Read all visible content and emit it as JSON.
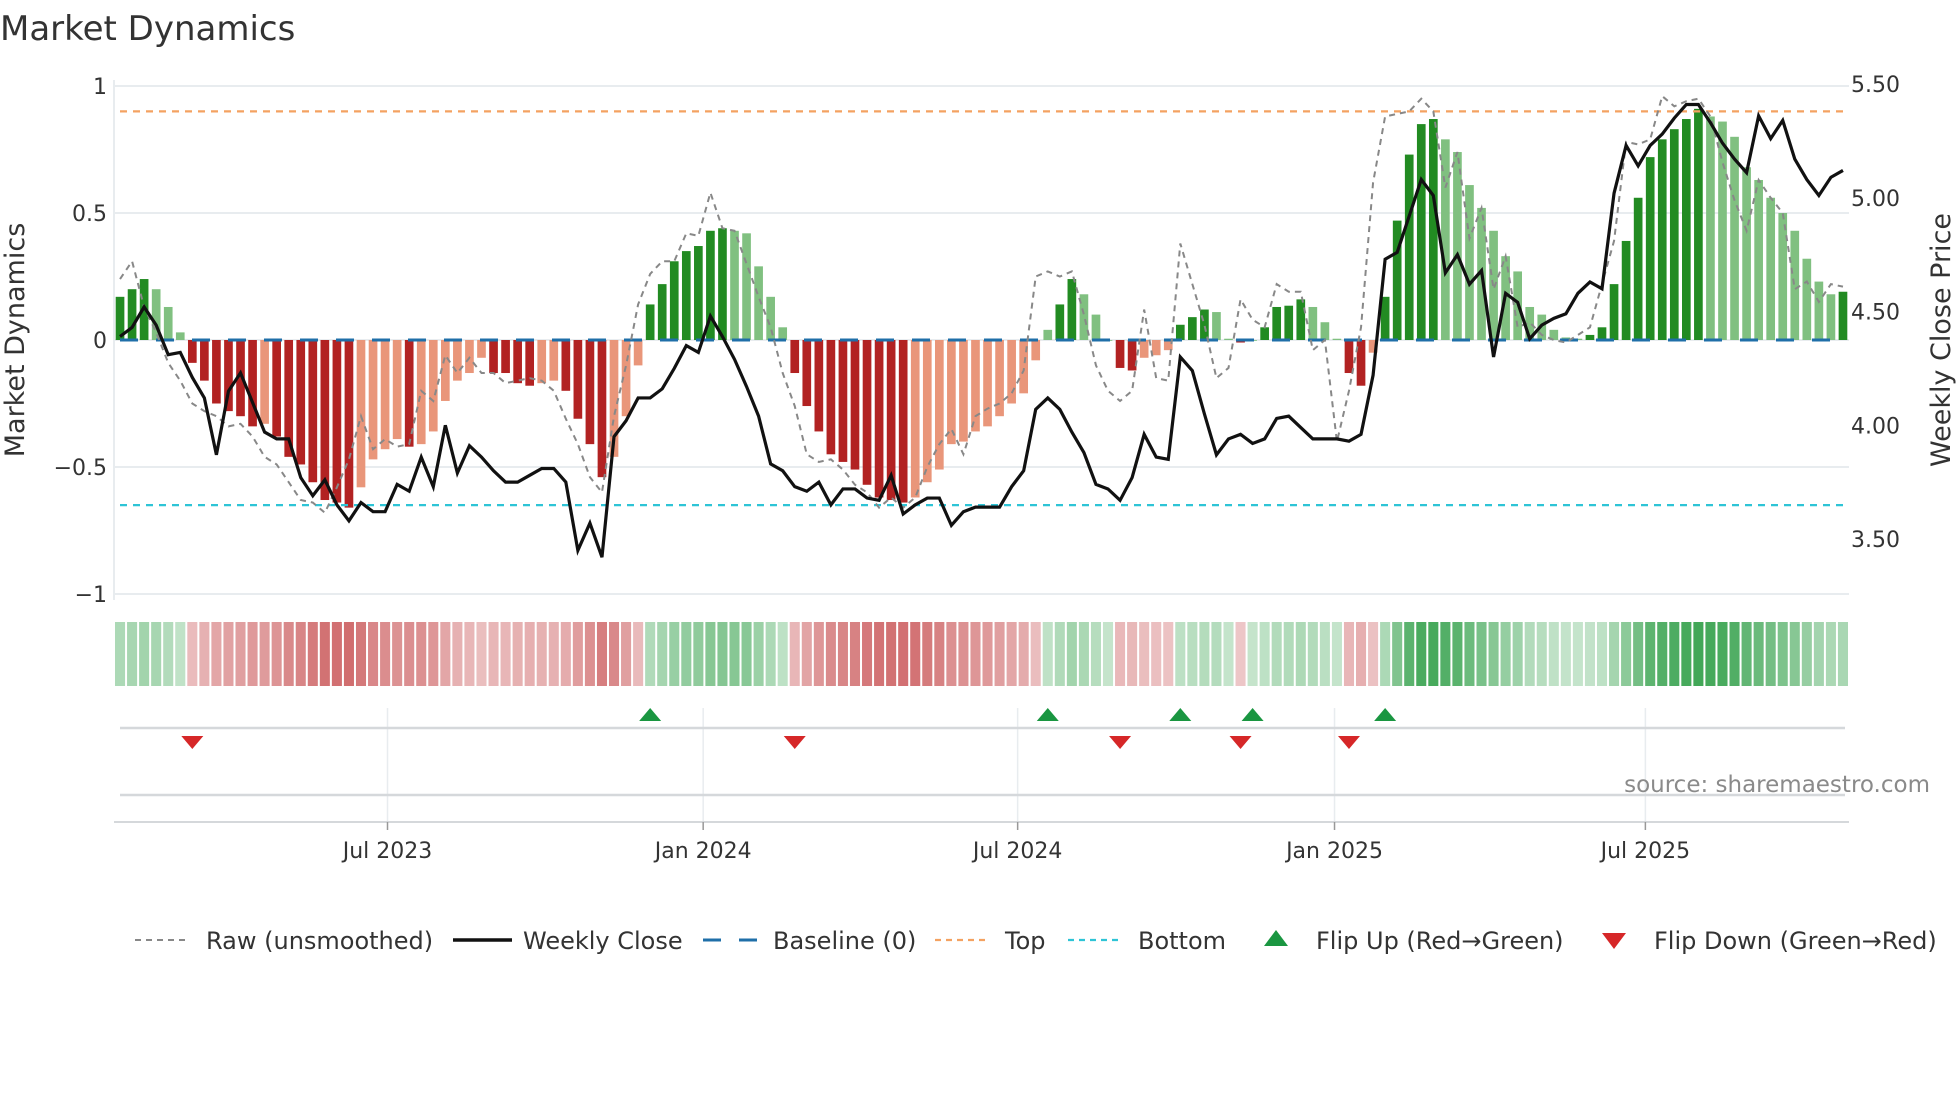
{
  "title": "Market Dynamics",
  "source": "source: sharemaestro.com",
  "chart_data": {
    "type": "bar",
    "title": "Market Dynamics",
    "ylabel": "Market Dynamics",
    "y2label": "Weekly Close Price",
    "ylim": [
      -1,
      1
    ],
    "y2lim": [
      3.5,
      5.5
    ],
    "yticks": [
      {
        "v": 1,
        "label": "1"
      },
      {
        "v": 0.5,
        "label": "0.5"
      },
      {
        "v": 0,
        "label": "0"
      },
      {
        "v": -0.5,
        "label": "−0.5"
      },
      {
        "v": -1,
        "label": "−1"
      }
    ],
    "y2ticks": [
      {
        "v": 5.5,
        "label": "5.50"
      },
      {
        "v": 5.0,
        "label": "5.00"
      },
      {
        "v": 4.5,
        "label": "4.50"
      },
      {
        "v": 4.0,
        "label": "4.00"
      },
      {
        "v": 3.5,
        "label": "3.50"
      }
    ],
    "xticks": [
      {
        "week": 22.2,
        "label": "Jul 2023"
      },
      {
        "week": 48.4,
        "label": "Jan 2024"
      },
      {
        "week": 74.5,
        "label": "Jul 2024"
      },
      {
        "week": 100.8,
        "label": "Jan 2025"
      },
      {
        "week": 126.6,
        "label": "Jul 2025"
      }
    ],
    "grid": true,
    "top_level": 0.9,
    "bottom_level": -0.65,
    "baseline": 0,
    "values": [
      0.17,
      0.2,
      0.24,
      0.2,
      0.13,
      0.03,
      -0.09,
      -0.16,
      -0.25,
      -0.28,
      -0.3,
      -0.34,
      -0.33,
      -0.38,
      -0.46,
      -0.49,
      -0.56,
      -0.63,
      -0.64,
      -0.66,
      -0.58,
      -0.47,
      -0.43,
      -0.39,
      -0.42,
      -0.41,
      -0.36,
      -0.24,
      -0.16,
      -0.13,
      -0.07,
      -0.13,
      -0.13,
      -0.17,
      -0.18,
      -0.17,
      -0.16,
      -0.2,
      -0.31,
      -0.41,
      -0.54,
      -0.46,
      -0.3,
      -0.1,
      0.14,
      0.22,
      0.31,
      0.35,
      0.37,
      0.43,
      0.44,
      0.43,
      0.42,
      0.29,
      0.17,
      0.05,
      -0.13,
      -0.26,
      -0.36,
      -0.45,
      -0.48,
      -0.51,
      -0.57,
      -0.62,
      -0.63,
      -0.64,
      -0.62,
      -0.56,
      -0.51,
      -0.41,
      -0.4,
      -0.36,
      -0.34,
      -0.3,
      -0.25,
      -0.21,
      -0.08,
      0.04,
      0.14,
      0.24,
      0.18,
      0.1,
      0.0,
      -0.11,
      -0.12,
      -0.07,
      -0.06,
      -0.04,
      0.06,
      0.09,
      0.12,
      0.11,
      0.005,
      -0.01,
      0.0,
      0.05,
      0.13,
      0.135,
      0.16,
      0.13,
      0.07,
      0.005,
      -0.13,
      -0.18,
      -0.05,
      0.17,
      0.47,
      0.73,
      0.85,
      0.87,
      0.79,
      0.74,
      0.61,
      0.52,
      0.43,
      0.33,
      0.27,
      0.13,
      0.1,
      0.04,
      0.01,
      0.005,
      0.02,
      0.05,
      0.22,
      0.39,
      0.56,
      0.72,
      0.79,
      0.83,
      0.87,
      0.91,
      0.88,
      0.86,
      0.8,
      0.68,
      0.63,
      0.56,
      0.5,
      0.43,
      0.32,
      0.23,
      0.18,
      0.19
    ],
    "raw": [
      0.24,
      0.31,
      0.13,
      0.03,
      -0.09,
      -0.16,
      -0.25,
      -0.28,
      -0.3,
      -0.34,
      -0.33,
      -0.38,
      -0.46,
      -0.49,
      -0.56,
      -0.63,
      -0.64,
      -0.68,
      -0.58,
      -0.47,
      -0.3,
      -0.43,
      -0.39,
      -0.42,
      -0.41,
      -0.2,
      -0.24,
      -0.06,
      -0.13,
      -0.07,
      -0.13,
      -0.13,
      -0.17,
      -0.16,
      -0.15,
      -0.16,
      -0.2,
      -0.31,
      -0.41,
      -0.54,
      -0.6,
      -0.3,
      -0.1,
      0.14,
      0.26,
      0.31,
      0.31,
      0.42,
      0.41,
      0.58,
      0.44,
      0.43,
      0.3,
      0.17,
      0.05,
      -0.13,
      -0.26,
      -0.45,
      -0.48,
      -0.47,
      -0.51,
      -0.57,
      -0.6,
      -0.66,
      -0.62,
      -0.66,
      -0.62,
      -0.5,
      -0.41,
      -0.35,
      -0.45,
      -0.3,
      -0.27,
      -0.25,
      -0.21,
      -0.12,
      0.25,
      0.27,
      0.25,
      0.27,
      0.1,
      -0.1,
      -0.2,
      -0.24,
      -0.2,
      0.12,
      -0.15,
      -0.16,
      0.38,
      0.22,
      0.06,
      -0.15,
      -0.11,
      0.16,
      0.08,
      0.05,
      0.22,
      0.19,
      0.19,
      -0.04,
      0.0,
      -0.4,
      -0.2,
      0.05,
      0.62,
      0.88,
      0.89,
      0.9,
      0.95,
      0.9,
      0.6,
      0.74,
      0.4,
      0.52,
      0.2,
      0.33,
      0.05,
      0.07,
      0.02,
      0.0,
      -0.01,
      0.02,
      0.05,
      0.22,
      0.39,
      0.78,
      0.77,
      0.79,
      0.96,
      0.92,
      0.94,
      0.95,
      0.88,
      0.7,
      0.55,
      0.43,
      0.63,
      0.56,
      0.5,
      0.2,
      0.23,
      0.15,
      0.22,
      0.21
    ],
    "close": [
      4.39,
      4.43,
      4.52,
      4.44,
      4.31,
      4.32,
      4.21,
      4.12,
      3.87,
      4.15,
      4.23,
      4.1,
      3.97,
      3.94,
      3.94,
      3.77,
      3.69,
      3.76,
      3.65,
      3.58,
      3.66,
      3.62,
      3.62,
      3.74,
      3.71,
      3.86,
      3.73,
      4.0,
      3.79,
      3.91,
      3.86,
      3.8,
      3.75,
      3.75,
      3.78,
      3.81,
      3.81,
      3.75,
      3.45,
      3.57,
      3.42,
      3.95,
      4.02,
      4.12,
      4.12,
      4.16,
      4.25,
      4.35,
      4.32,
      4.48,
      4.39,
      4.29,
      4.17,
      4.04,
      3.83,
      3.8,
      3.73,
      3.71,
      3.75,
      3.65,
      3.72,
      3.72,
      3.68,
      3.67,
      3.78,
      3.61,
      3.65,
      3.68,
      3.68,
      3.56,
      3.62,
      3.64,
      3.64,
      3.64,
      3.73,
      3.8,
      4.07,
      4.12,
      4.07,
      3.97,
      3.88,
      3.74,
      3.72,
      3.67,
      3.77,
      3.96,
      3.86,
      3.85,
      4.3,
      4.24,
      4.05,
      3.87,
      3.94,
      3.96,
      3.92,
      3.94,
      4.03,
      4.04,
      3.99,
      3.94,
      3.94,
      3.94,
      3.93,
      3.96,
      4.22,
      4.73,
      4.76,
      4.92,
      5.08,
      5.01,
      4.67,
      4.75,
      4.62,
      4.68,
      4.3,
      4.58,
      4.54,
      4.38,
      4.44,
      4.47,
      4.49,
      4.58,
      4.63,
      4.6,
      5.02,
      5.23,
      5.14,
      5.23,
      5.28,
      5.35,
      5.41,
      5.41,
      5.33,
      5.24,
      5.17,
      5.11,
      5.36,
      5.26,
      5.34,
      5.17,
      5.08,
      5.01,
      5.09,
      5.12
    ],
    "flip_up_weeks": [
      44,
      77,
      88,
      94,
      105
    ],
    "flip_down_weeks": [
      6,
      56,
      83,
      93,
      102
    ],
    "legend": {
      "placement": "bottom",
      "items": [
        {
          "label": "Raw (unsmoothed)",
          "kind": "raw"
        },
        {
          "label": "Weekly Close",
          "kind": "close"
        },
        {
          "label": "Baseline (0)",
          "kind": "baseline"
        },
        {
          "label": "Top",
          "kind": "top"
        },
        {
          "label": "Bottom",
          "kind": "bottom"
        },
        {
          "label": "Flip Up (Red→Green)",
          "kind": "flipup"
        },
        {
          "label": "Flip Down (Green→Red)",
          "kind": "flipdown"
        }
      ]
    },
    "colors": {
      "pos_strong": "#228b22",
      "pos_weak": "#80c080",
      "neg_strong": "#b22222",
      "neg_weak": "#e9967a",
      "raw": "#888888",
      "close": "#111111",
      "baseline": "#1f6fa8",
      "top": "#f4a261",
      "bottom": "#2ec4d6",
      "flip_up": "#1a9641",
      "flip_down": "#d62728",
      "grid": "#e8ecef"
    }
  }
}
